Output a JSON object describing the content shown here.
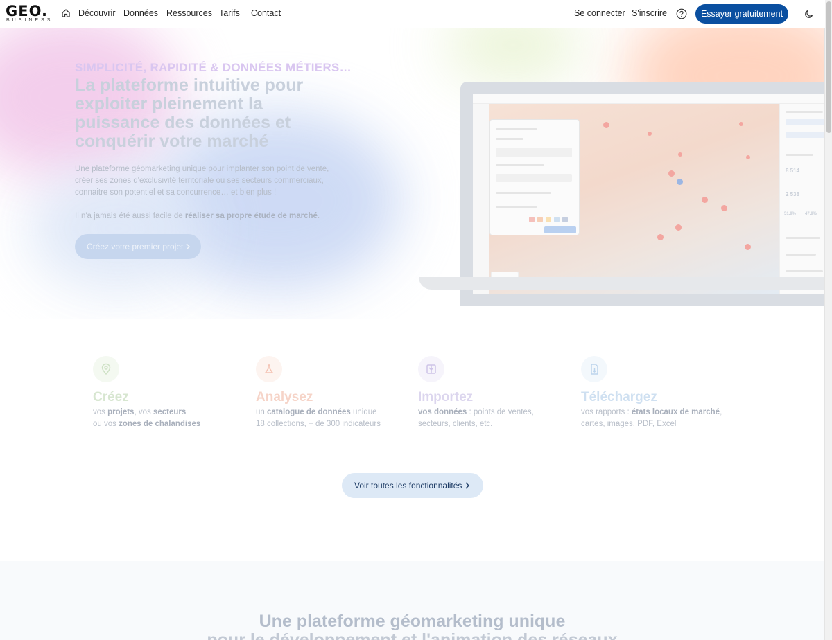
{
  "nav": {
    "logo_main": "GEO.",
    "logo_sub": "BUSINESS",
    "links": [
      "Découvrir",
      "Données",
      "Ressources",
      "Tarifs",
      "Contact"
    ],
    "login": "Se connecter",
    "signup": "S'inscrire",
    "cta": "Essayer gratuitement",
    "accent": "#0a4fa0"
  },
  "hero": {
    "kicker": "SIMPLICITÉ, RAPIDITÉ & DONNÉES MÉTIERS…",
    "title": "La plateforme intuitive pour exploiter pleinement la puissance des données et conquérir votre marché",
    "text": "Une plateforme géomarketing unique pour implanter son point de vente, créer ses zones d'exclusivité territoriale ou ses secteurs commerciaux, connaitre son potentiel et sa concurrence… et bien plus !",
    "text2_prefix": "Il n'a jamais été aussi facile de ",
    "text2_bold": "réaliser sa propre étude de marché",
    "text2_suffix": ".",
    "button": "Créez votre premier projet",
    "mockup": {
      "stat1": "8 514",
      "stat2": "2 538",
      "pct1": "51.9%",
      "pct2": "47.9%"
    }
  },
  "features": [
    {
      "title": "Créez",
      "color": "#d7e6d0",
      "icon": "map-pin-icon",
      "line1": [
        "vos ",
        "projets",
        ", vos ",
        "secteurs"
      ],
      "line2": [
        "ou vos ",
        "zones de chalandises",
        "",
        ""
      ]
    },
    {
      "title": "Analysez",
      "color": "#f6d4c8",
      "icon": "flask-icon",
      "line1": [
        "un ",
        "catalogue de données",
        " unique",
        ""
      ],
      "line2": [
        "18 collections, + de 300 indicateurs",
        "",
        "",
        ""
      ]
    },
    {
      "title": "Importez",
      "color": "#dcd6ee",
      "icon": "import-icon",
      "line1": [
        "",
        "vos données",
        " : points de ventes,",
        ""
      ],
      "line2": [
        "secteurs, clients, etc.",
        "",
        "",
        ""
      ]
    },
    {
      "title": "Téléchargez",
      "color": "#cfe0f1",
      "icon": "file-download-icon",
      "line1": [
        "vos rapports : ",
        "états locaux de marché",
        ",",
        ""
      ],
      "line2": [
        "cartes, images, PDF, Excel",
        "",
        "",
        ""
      ]
    }
  ],
  "all_features_button": "Voir toutes les fonctionnalités",
  "band": {
    "title_line1": "Une plateforme géomarketing unique",
    "title_line2": "pour le développement et l'animation des réseaux"
  }
}
